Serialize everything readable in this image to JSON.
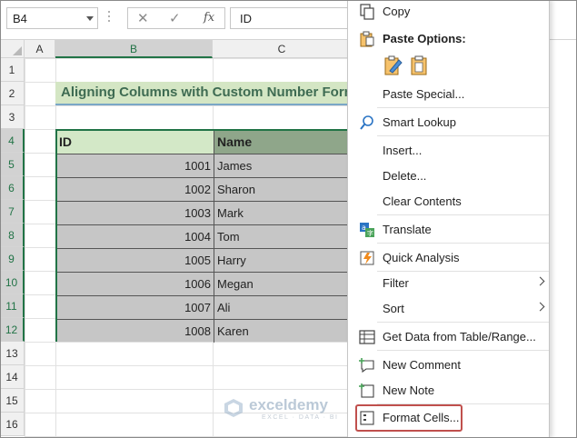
{
  "formula_bar": {
    "name_box": "B4",
    "cancel_glyph": "✕",
    "enter_glyph": "✓",
    "fx_label": "fx",
    "formula_value": "ID"
  },
  "columns": [
    "A",
    "B",
    "C"
  ],
  "rows": [
    "1",
    "2",
    "3",
    "4",
    "5",
    "6",
    "7",
    "8",
    "9",
    "10",
    "11",
    "12",
    "13",
    "14",
    "15",
    "16"
  ],
  "sheet": {
    "title": "Aligning Columns with Custom Number Form",
    "headers": {
      "id": "ID",
      "name": "Name"
    },
    "data": [
      {
        "id": "1001",
        "name": "James"
      },
      {
        "id": "1002",
        "name": "Sharon"
      },
      {
        "id": "1003",
        "name": "Mark"
      },
      {
        "id": "1004",
        "name": "Tom"
      },
      {
        "id": "1005",
        "name": "Harry"
      },
      {
        "id": "1006",
        "name": "Megan"
      },
      {
        "id": "1007",
        "name": "Ali"
      },
      {
        "id": "1008",
        "name": "Karen"
      }
    ]
  },
  "watermark": {
    "name": "exceldemy",
    "tagline": "EXCEL · DATA · BI"
  },
  "context_menu": {
    "copy": "Copy",
    "paste_options": "Paste Options:",
    "paste_special": "Paste Special...",
    "smart_lookup": "Smart Lookup",
    "insert": "Insert...",
    "delete": "Delete...",
    "clear_contents": "Clear Contents",
    "translate": "Translate",
    "quick_analysis": "Quick Analysis",
    "filter": "Filter",
    "sort": "Sort",
    "get_data": "Get Data from Table/Range...",
    "new_comment": "New Comment",
    "new_note": "New Note",
    "format_cells": "Format Cells..."
  },
  "colors": {
    "accent_green": "#217346",
    "title_fill": "#d4e6c4",
    "header_name_fill": "#8fa68a",
    "selection_gray": "#c6c6c6",
    "highlight_red": "#c0504d"
  }
}
